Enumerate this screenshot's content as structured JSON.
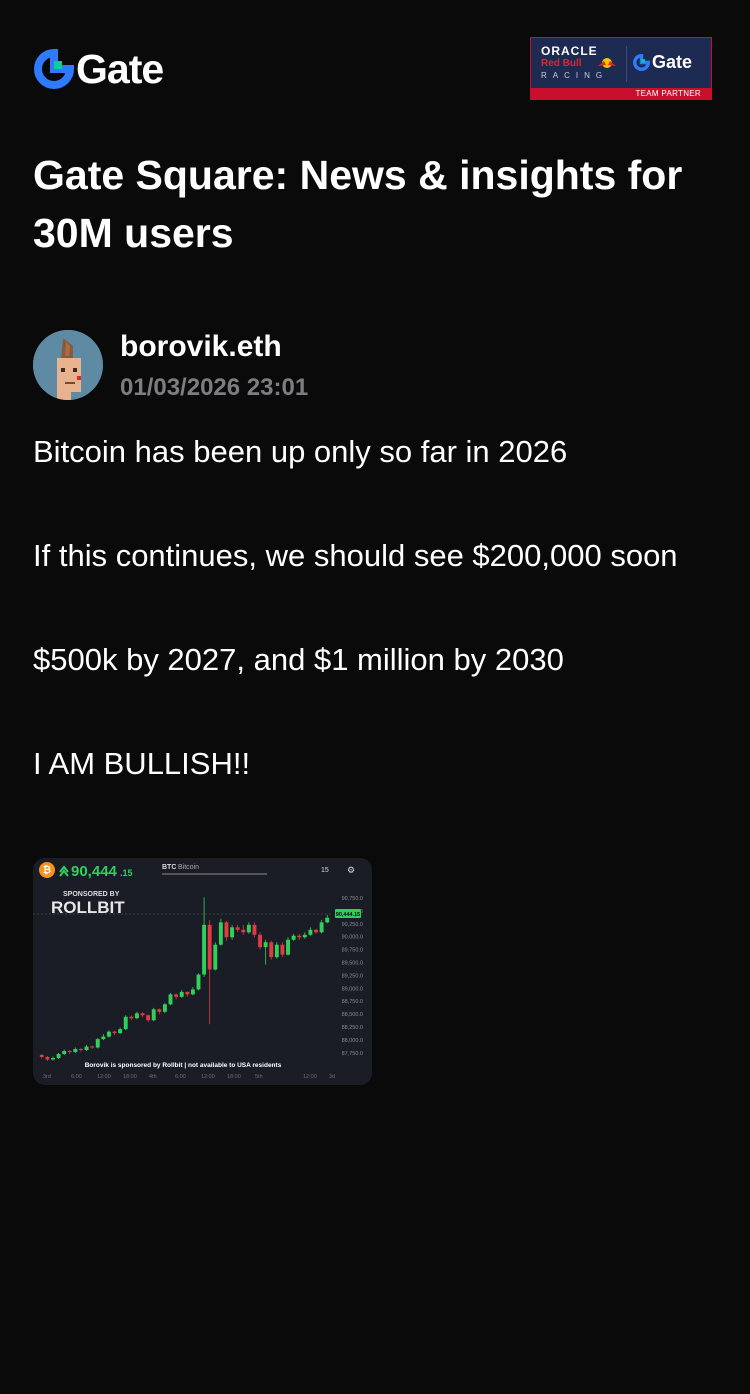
{
  "brand": {
    "name": "Gate",
    "logo_icon": "gate-logo-icon",
    "accent": "#2e7bff",
    "accent2": "#00d29a"
  },
  "partner_badge": {
    "oracle": "ORACLE",
    "redbull": "Red Bull",
    "racing": "RACING",
    "gate": "Gate",
    "strip": "TEAM PARTNER",
    "bg": "#1d2a52",
    "strip_color": "#c8102e"
  },
  "page": {
    "title": "Gate Square: News & insights for 30M users"
  },
  "post": {
    "author": "borovik.eth",
    "date": "01/03/2026 23:01",
    "paragraphs": [
      "Bitcoin has been up only so far in 2026",
      "If this continues, we should see $200,000 soon",
      "$500k by 2027, and $1 million by 2030",
      "I AM BULLISH!!"
    ]
  },
  "chart_image": {
    "price": "90,444",
    "price_decimals": ".15",
    "symbol": "BTC",
    "name": "Bitcoin",
    "interval": "15",
    "sponsored_label": "SPONSORED BY",
    "sponsor_name": "ROLLBIT",
    "disclaimer": "Borovik is sponsored by Rollbit | not available to USA residents",
    "current_price_tag": "90,444.15",
    "up_color": "#2fd15a",
    "down_color": "#e03a45",
    "y_ticks": [
      "90,750.0",
      "90,500.0",
      "90,250.0",
      "90,000.0",
      "89,750.0",
      "89,500.0",
      "89,250.0",
      "89,000.0",
      "88,750.0",
      "88,500.0",
      "88,250.0",
      "88,000.0",
      "87,750.0"
    ],
    "x_ticks": [
      "3rd",
      "6:00",
      "12:00",
      "18:00",
      "4th",
      "6:00",
      "12:00",
      "18:00",
      "5th",
      "12:00",
      "3d"
    ],
    "candles": [
      [
        87680,
        87640,
        87700,
        87610
      ],
      [
        87640,
        87590,
        87660,
        87560
      ],
      [
        87590,
        87620,
        87650,
        87570
      ],
      [
        87620,
        87700,
        87720,
        87600
      ],
      [
        87700,
        87760,
        87790,
        87680
      ],
      [
        87760,
        87740,
        87780,
        87700
      ],
      [
        87740,
        87800,
        87830,
        87720
      ],
      [
        87800,
        87780,
        87820,
        87750
      ],
      [
        87780,
        87850,
        87880,
        87760
      ],
      [
        87850,
        87830,
        87870,
        87800
      ],
      [
        87830,
        88000,
        88020,
        87810
      ],
      [
        88000,
        88050,
        88100,
        87980
      ],
      [
        88050,
        88150,
        88180,
        88030
      ],
      [
        88150,
        88120,
        88170,
        88080
      ],
      [
        88120,
        88200,
        88230,
        88100
      ],
      [
        88200,
        88450,
        88480,
        88180
      ],
      [
        88450,
        88420,
        88480,
        88380
      ],
      [
        88420,
        88520,
        88550,
        88400
      ],
      [
        88520,
        88480,
        88540,
        88440
      ],
      [
        88480,
        88380,
        88500,
        88340
      ],
      [
        88380,
        88600,
        88630,
        88360
      ],
      [
        88600,
        88550,
        88620,
        88500
      ],
      [
        88550,
        88700,
        88730,
        88520
      ],
      [
        88700,
        88900,
        88930,
        88680
      ],
      [
        88900,
        88850,
        88920,
        88800
      ],
      [
        88850,
        88950,
        88990,
        88830
      ],
      [
        88950,
        88900,
        88960,
        88850
      ],
      [
        88900,
        89000,
        89050,
        88880
      ],
      [
        89000,
        89300,
        89320,
        88980
      ],
      [
        89300,
        90300,
        90850,
        89250
      ],
      [
        90300,
        89400,
        90400,
        88300
      ],
      [
        89400,
        89900,
        89950,
        89380
      ],
      [
        89900,
        90350,
        90420,
        89880
      ],
      [
        90350,
        90050,
        90380,
        89980
      ],
      [
        90050,
        90250,
        90300,
        90000
      ],
      [
        90250,
        90200,
        90300,
        90150
      ],
      [
        90200,
        90150,
        90300,
        90100
      ],
      [
        90150,
        90300,
        90350,
        90120
      ],
      [
        90300,
        90100,
        90350,
        90050
      ],
      [
        90100,
        89850,
        90150,
        89800
      ],
      [
        89850,
        89950,
        90000,
        89500
      ],
      [
        89950,
        89650,
        89980,
        89600
      ],
      [
        89650,
        89900,
        89950,
        89620
      ],
      [
        89900,
        89700,
        89950,
        89650
      ],
      [
        89700,
        90000,
        90050,
        89680
      ],
      [
        90000,
        90080,
        90120,
        89980
      ],
      [
        90080,
        90050,
        90120,
        90000
      ],
      [
        90050,
        90100,
        90150,
        90020
      ],
      [
        90100,
        90200,
        90250,
        90080
      ],
      [
        90200,
        90150,
        90220,
        90120
      ],
      [
        90150,
        90350,
        90400,
        90130
      ],
      [
        90350,
        90444,
        90500,
        90330
      ]
    ]
  }
}
